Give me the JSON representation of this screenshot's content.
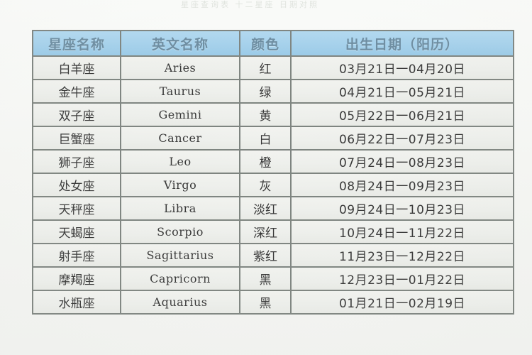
{
  "page": {
    "top_cropped_text": "星座查询表  十二星座  日期对照"
  },
  "table": {
    "headers": {
      "name": "星座名称",
      "english": "英文名称",
      "color": "颜色",
      "birthdate": "出生日期（阳历）"
    },
    "rows": [
      {
        "name": "白羊座",
        "english": "Aries",
        "color": "红",
        "birthdate": "03月21日一04月20日"
      },
      {
        "name": "金牛座",
        "english": "Taurus",
        "color": "绿",
        "birthdate": "04月21日一05月21日"
      },
      {
        "name": "双子座",
        "english": "Gemini",
        "color": "黄",
        "birthdate": "05月22日一06月21日"
      },
      {
        "name": "巨蟹座",
        "english": "Cancer",
        "color": "白",
        "birthdate": "06月22日一07月23日"
      },
      {
        "name": "狮子座",
        "english": "Leo",
        "color": "橙",
        "birthdate": "07月24日一08月23日"
      },
      {
        "name": "处女座",
        "english": "Virgo",
        "color": "灰",
        "birthdate": "08月24日一09月23日"
      },
      {
        "name": "天秤座",
        "english": "Libra",
        "color": "淡红",
        "birthdate": "09月24日一10月23日"
      },
      {
        "name": "天蝎座",
        "english": "Scorpio",
        "color": "深红",
        "birthdate": "10月24日一11月22日"
      },
      {
        "name": "射手座",
        "english": "Sagittarius",
        "color": "紫红",
        "birthdate": "11月23日一12月22日"
      },
      {
        "name": "摩羯座",
        "english": "Capricorn",
        "color": "黑",
        "birthdate": "12月23日一01月22日"
      },
      {
        "name": "水瓶座",
        "english": "Aquarius",
        "color": "黑",
        "birthdate": "01月21日一02月19日"
      }
    ]
  },
  "colors": {
    "header_background": "#9ccdeb",
    "header_text": "#5b7f96",
    "cell_background": "#eceeea",
    "cell_text": "#1d1d1d",
    "grid_line": "#6f7671",
    "page_background": "#f5f6f3"
  }
}
